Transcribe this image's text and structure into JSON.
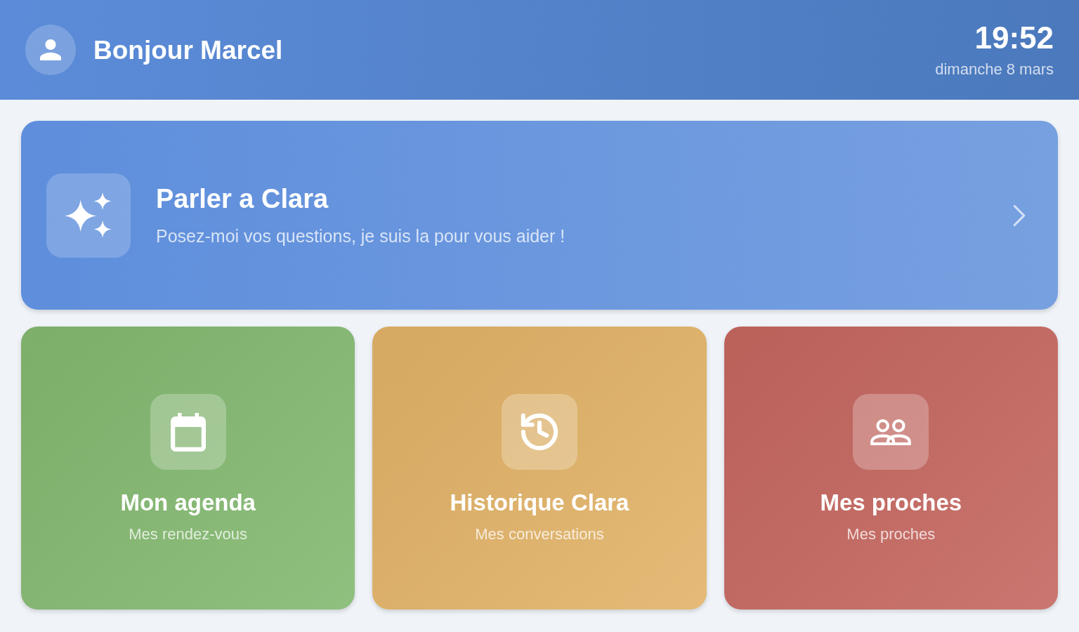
{
  "header": {
    "greeting": "Bonjour Marcel",
    "time": "19:52",
    "date": "dimanche 8 mars"
  },
  "assistant_card": {
    "title": "Parler a Clara",
    "subtitle": "Posez-moi vos questions, je suis la pour vous aider !"
  },
  "tiles": [
    {
      "title": "Mon agenda",
      "subtitle": "Mes rendez-vous",
      "color": "#84b971"
    },
    {
      "title": "Historique Clara",
      "subtitle": "Mes conversations",
      "color": "#e2b368"
    },
    {
      "title": "Mes proches",
      "subtitle": "Mes proches",
      "color": "#c56760"
    }
  ]
}
